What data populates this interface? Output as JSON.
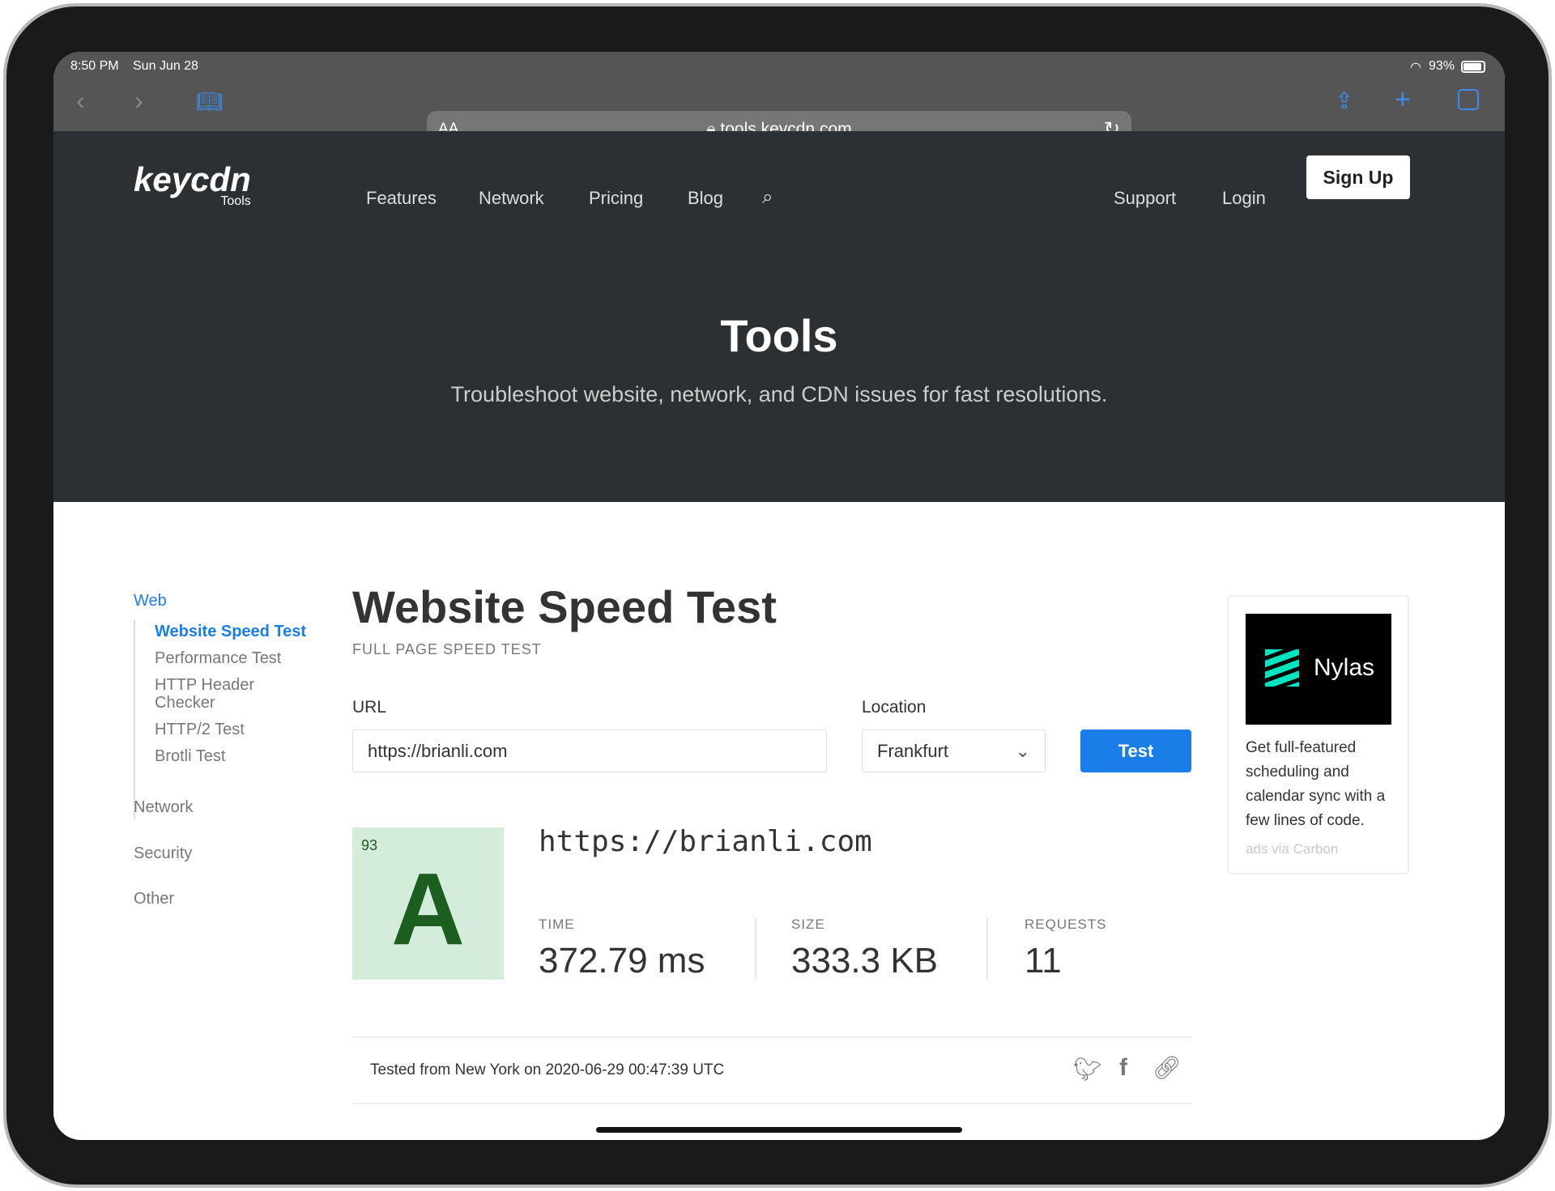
{
  "status": {
    "time": "8:50 PM",
    "date": "Sun Jun 28",
    "battery": "93%"
  },
  "browser": {
    "text_size": "AA",
    "url": "tools.keycdn.com"
  },
  "site": {
    "logo": "keycdn",
    "logo_sub": "Tools",
    "nav": [
      "Features",
      "Network",
      "Pricing",
      "Blog"
    ],
    "support": "Support",
    "login": "Login",
    "signup": "Sign Up"
  },
  "hero": {
    "title": "Tools",
    "subtitle": "Troubleshoot website, network, and CDN issues for fast resolutions."
  },
  "sidebar": {
    "web": "Web",
    "web_items": [
      "Website Speed Test",
      "Performance Test",
      "HTTP Header Checker",
      "HTTP/2 Test",
      "Brotli Test"
    ],
    "sections": [
      "Network",
      "Security",
      "Other"
    ]
  },
  "main": {
    "title": "Website Speed Test",
    "subtitle": "FULL PAGE SPEED TEST",
    "url_label": "URL",
    "url_value": "https://brianli.com",
    "location_label": "Location",
    "location_value": "Frankfurt",
    "test_button": "Test",
    "result": {
      "score": "93",
      "grade": "A",
      "url": "https://brianli.com",
      "stats": [
        {
          "label": "TIME",
          "value": "372.79 ms"
        },
        {
          "label": "SIZE",
          "value": "333.3 KB"
        },
        {
          "label": "REQUESTS",
          "value": "11"
        }
      ],
      "tested": "Tested from New York on 2020-06-29 00:47:39 UTC"
    }
  },
  "ad": {
    "brand": "Nylas",
    "text": "Get full-featured scheduling and calendar sync with a few lines of code.",
    "via": "ads via Carbon"
  },
  "colors": {
    "accent": "#1a7ee8",
    "header": "#2c3033",
    "grade_bg": "#d4edda",
    "grade_fg": "#1b5e20"
  }
}
